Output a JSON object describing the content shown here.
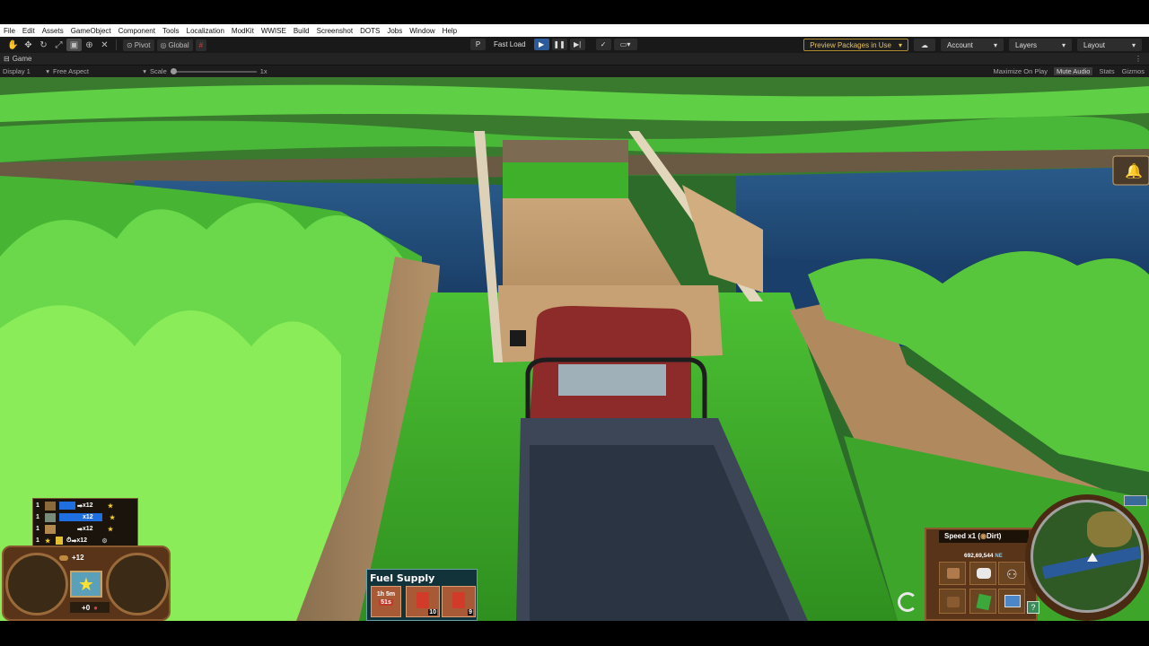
{
  "menu": [
    "File",
    "Edit",
    "Assets",
    "GameObject",
    "Component",
    "Tools",
    "Localization",
    "ModKit",
    "WWISE",
    "Build",
    "Screenshot",
    "DOTS",
    "Jobs",
    "Window",
    "Help"
  ],
  "toolbar": {
    "pivot_label": "Pivot",
    "global_label": "Global",
    "p_label": "P",
    "fast_load_label": "Fast Load",
    "preview_packages_label": "Preview Packages in Use",
    "account_label": "Account",
    "layers_label": "Layers",
    "layout_label": "Layout"
  },
  "tab": {
    "game_label": "Game"
  },
  "gamebar": {
    "display_label": "Display 1",
    "aspect_label": "Free Aspect",
    "scale_label": "Scale",
    "scale_value": "1x",
    "maximize_label": "Maximize On Play",
    "mute_label": "Mute Audio",
    "stats_label": "Stats",
    "gizmos_label": "Gizmos"
  },
  "hud": {
    "resources": [
      {
        "count": "1",
        "mult": "x12"
      },
      {
        "count": "1",
        "mult": "x12"
      },
      {
        "count": "1",
        "mult": "x12"
      },
      {
        "count": "1",
        "mult": "x12"
      }
    ],
    "wood_bonus": "+12",
    "bottom_bonus": "+0",
    "fuel_supply_title": "Fuel Supply",
    "fuel_slots": [
      {
        "time": "1h 5m",
        "sub": "51s"
      },
      {
        "count": "10"
      },
      {
        "count": "9"
      }
    ],
    "speed_label": "Speed x1 (",
    "speed_terrain": "Dirt)",
    "money_value": "692,69,544"
  },
  "colors": {
    "sky_water": "#1d3d66",
    "grass": "#3fae2a",
    "truck_red": "#8d2a2a",
    "truck_bed": "#3c4656",
    "ui_brown": "#6b3d1e",
    "unity_dark": "#191919"
  },
  "icons": [
    "hand-tool-icon",
    "move-tool-icon",
    "rotate-tool-icon",
    "scale-tool-icon",
    "rect-tool-icon",
    "transform-tool-icon",
    "custom-tool-icon",
    "play-icon",
    "pause-icon",
    "step-icon",
    "cloud-icon",
    "star-icon",
    "bell-icon",
    "spiral-logo-icon",
    "minimap-icon"
  ]
}
